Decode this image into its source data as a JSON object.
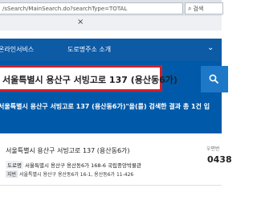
{
  "browser": {
    "url": "/sSearch/MainSearch.do?searchType=TOTAL",
    "search_placeholder": "검색",
    "tab_close": "×"
  },
  "nav": {
    "items": [
      {
        "label": "온라인서비스"
      },
      {
        "label": "도로명주소 소개"
      }
    ]
  },
  "search": {
    "query": "서울특별시 용산구 서빙고로 137 (용산동6가)",
    "result_summary": "서울특별시 용산구 서빙고로 137 (용산동6가)\"을(를) 검색한 결과 총 1건 입"
  },
  "result": {
    "title": "서울특별시 용산구 서빙고로 137 (용산동6가)",
    "line1_tag": "도로명",
    "line1_text": "서울특별시 용산구 용산동6가 168-6  국립중앙박물관",
    "line2_tag": "지번",
    "line2_text": "서울특별시 용산구 용산동6가 16-1, 용산동6가 11-426",
    "side_label": "우편번",
    "zip": "0438"
  },
  "colors": {
    "nav_bg": "#0d5aa5",
    "band_bg": "#005aa9",
    "highlight": "#d11f2b",
    "button": "#1d78c7"
  }
}
